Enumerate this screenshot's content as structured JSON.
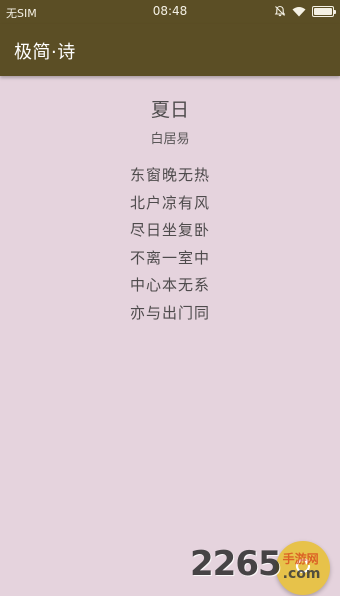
{
  "status_bar": {
    "carrier": "无SIM",
    "time": "08:48",
    "icons": [
      "alarm-off-icon",
      "wifi-icon",
      "battery-icon"
    ],
    "battery_level": 1.0
  },
  "app_bar": {
    "title": "极简·诗"
  },
  "poem": {
    "title": "夏日",
    "author": "白居易",
    "lines": [
      "东窗晚无热",
      "北户凉有风",
      "尽日坐复卧",
      "不离一室中",
      "中心本无系",
      "亦与出门同"
    ]
  },
  "fab": {
    "icon": "refresh-icon"
  },
  "watermark": {
    "number": "2265",
    "text_cn": "手游网",
    "text_com": ".com"
  },
  "colors": {
    "toolbar": "#5b4e25",
    "background": "#e5d3dd",
    "text": "#4e4b4c",
    "fab": "#e7c24a"
  }
}
